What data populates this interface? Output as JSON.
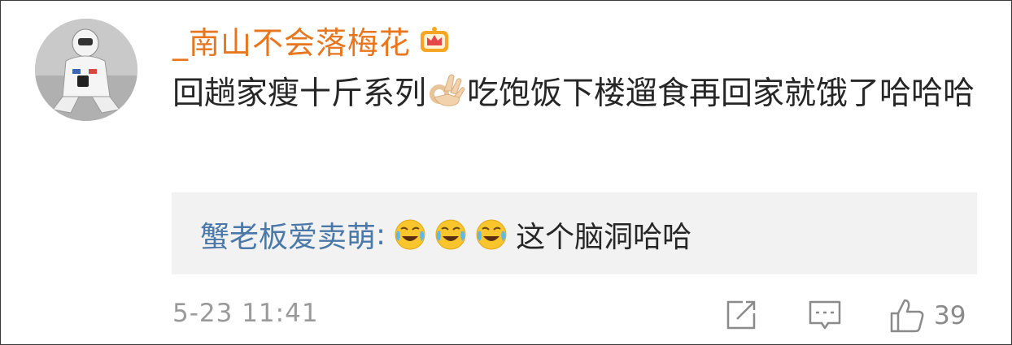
{
  "post": {
    "username": "_南山不会落梅花",
    "badge_icon": "crown-vip-icon",
    "text_before_emoji": "回趟家瘦十斤系列",
    "emoji": "ok-hand-emoji",
    "text_after_emoji": "吃饱饭下楼遛食再回家就饿了哈哈哈",
    "timestamp": "5-23 11:41"
  },
  "reply": {
    "username": "蟹老板爱卖萌",
    "colon": ":",
    "emojis": [
      "laugh-cry-emoji",
      "laugh-cry-emoji",
      "laugh-cry-emoji"
    ],
    "text": "这个脑洞哈哈"
  },
  "actions": {
    "share_icon": "share-edit-icon",
    "comment_icon": "comment-icon",
    "like_icon": "thumbs-up-icon",
    "like_count": "39"
  },
  "colors": {
    "username": "#e8761f",
    "reply_username": "#4a78a8",
    "reply_bg": "#f2f2f2",
    "meta": "#9a9a9a"
  }
}
